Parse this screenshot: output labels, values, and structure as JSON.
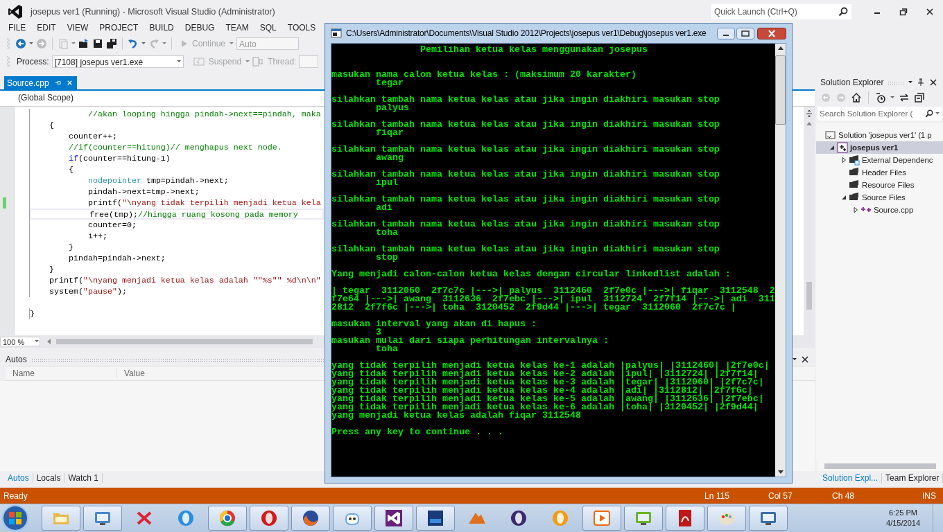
{
  "window": {
    "title": "josepus ver1 (Running) - Microsoft Visual Studio (Administrator)",
    "quick_launch": {
      "placeholder": "Quick Launch (Ctrl+Q)"
    }
  },
  "menu": [
    "FILE",
    "EDIT",
    "VIEW",
    "PROJECT",
    "BUILD",
    "DEBUG",
    "TEAM",
    "SQL",
    "TOOLS"
  ],
  "toolbar": {
    "continue": "Continue",
    "config": "Auto",
    "process_label": "Process:",
    "process": "[7108] josepus ver1.exe",
    "suspend": "Suspend",
    "thread_label": "Thread:"
  },
  "editor": {
    "tabs": [
      {
        "label": "Source.cpp",
        "selected": true
      }
    ],
    "scope": "(Global Scope)",
    "zoom": "100 %",
    "lines": [
      {
        "segments": [
          {
            "kind": "comment",
            "text": "            //akan looping hingga pindah->next==pindah, maka"
          }
        ]
      },
      {
        "segments": [
          {
            "kind": "plain",
            "text": "    {"
          }
        ]
      },
      {
        "segments": [
          {
            "kind": "plain",
            "text": "        counter++;"
          }
        ]
      },
      {
        "segments": [
          {
            "kind": "comment",
            "text": "        //if(counter==hitung)// menghapus next node."
          }
        ]
      },
      {
        "segments": [
          {
            "kind": "keyword",
            "text": "        if"
          },
          {
            "kind": "plain",
            "text": "(counter==hitung-1)"
          }
        ]
      },
      {
        "segments": [
          {
            "kind": "plain",
            "text": "        {"
          }
        ]
      },
      {
        "segments": [
          {
            "kind": "type",
            "text": "            nodepointer"
          },
          {
            "kind": "plain",
            "text": " tmp=pindah->next;"
          }
        ]
      },
      {
        "segments": [
          {
            "kind": "plain",
            "text": "            pindah->next=tmp->next;"
          }
        ]
      },
      {
        "changed": true,
        "segments": [
          {
            "kind": "plain",
            "text": "            printf("
          },
          {
            "kind": "string",
            "text": "\"\\nyang tidak terpilih menjadi ketua kela"
          }
        ]
      },
      {
        "current": true,
        "segments": [
          {
            "kind": "plain",
            "text": "            free(tmp);"
          },
          {
            "kind": "comment",
            "text": "//hingga ruang kosong pada memory"
          }
        ]
      },
      {
        "segments": [
          {
            "kind": "plain",
            "text": "            counter=0;"
          }
        ]
      },
      {
        "segments": [
          {
            "kind": "plain",
            "text": "            i++;"
          }
        ]
      },
      {
        "segments": [
          {
            "kind": "plain",
            "text": "        }"
          }
        ]
      },
      {
        "segments": [
          {
            "kind": "plain",
            "text": "        pindah=pindah->next;"
          }
        ]
      },
      {
        "segments": [
          {
            "kind": "plain",
            "text": "    }"
          }
        ]
      },
      {
        "segments": [
          {
            "kind": "plain",
            "text": "    printf("
          },
          {
            "kind": "string",
            "text": "\"\\nyang menjadi ketua kelas adalah \"\"%s\"\" %d\\n\\n\""
          }
        ]
      },
      {
        "segments": [
          {
            "kind": "plain",
            "text": "    system("
          },
          {
            "kind": "string",
            "text": "\"pause\""
          },
          {
            "kind": "plain",
            "text": ");"
          }
        ]
      },
      {
        "blank_before": true,
        "segments": [
          {
            "kind": "plain",
            "text": "}"
          }
        ]
      }
    ]
  },
  "autos": {
    "title": "Autos",
    "columns": [
      "Name",
      "Value"
    ],
    "tabs": [
      {
        "label": "Autos",
        "selected": true
      },
      {
        "label": "Locals",
        "selected": false
      },
      {
        "label": "Watch 1",
        "selected": false
      }
    ]
  },
  "solution_explorer": {
    "title": "Solution Explorer",
    "search": {
      "placeholder": "Search Solution Explorer ("
    },
    "tree": [
      {
        "label": "Solution 'josepus ver1' (1 p",
        "kind": "solution",
        "selected": false,
        "children": [
          {
            "label": "josepus ver1",
            "kind": "project",
            "expanded": true,
            "selected": true,
            "children": [
              {
                "label": "External Dependenc",
                "kind": "deps",
                "expanded": false,
                "selected": false
              },
              {
                "label": "Header Files",
                "kind": "folder",
                "selected": false
              },
              {
                "label": "Resource Files",
                "kind": "folder",
                "selected": false
              },
              {
                "label": "Source Files",
                "kind": "folder",
                "expanded": true,
                "selected": false,
                "children": [
                  {
                    "label": "Source.cpp",
                    "kind": "file",
                    "expanded": false,
                    "selected": false
                  }
                ]
              }
            ]
          }
        ]
      }
    ],
    "tabs": [
      {
        "label": "Solution Expl...",
        "selected": true
      },
      {
        "label": "Team Explorer",
        "selected": false
      }
    ]
  },
  "status_bar": {
    "state": "Ready",
    "line": "Ln 115",
    "col": "Col 57",
    "ch": "Ch 48",
    "mode": "INS"
  },
  "console": {
    "title": "C:\\Users\\Administrator\\Documents\\Visual Studio 2012\\Projects\\josepus ver1\\Debug\\josepus ver1.exe",
    "blocks": [
      [
        "                Pemilihan ketua kelas menggunakan josepus"
      ],
      [
        "masukan nama calon ketua kelas : (maksimum 20 karakter)",
        "        tegar"
      ],
      [
        "silahkan tambah nama ketua kelas atau jika ingin diakhiri masukan stop",
        "        palyus"
      ],
      [
        "silahkan tambah nama ketua kelas atau jika ingin diakhiri masukan stop",
        "        fiqar"
      ],
      [
        "silahkan tambah nama ketua kelas atau jika ingin diakhiri masukan stop",
        "        awang"
      ],
      [
        "silahkan tambah nama ketua kelas atau jika ingin diakhiri masukan stop",
        "        ipul"
      ],
      [
        "silahkan tambah nama ketua kelas atau jika ingin diakhiri masukan stop",
        "        adi"
      ],
      [
        "silahkan tambah nama ketua kelas atau jika ingin diakhiri masukan stop",
        "        toha"
      ],
      [
        "silahkan tambah nama ketua kelas atau jika ingin diakhiri masukan stop",
        "        stop"
      ],
      [
        "Yang menjadi calon-calon ketua kelas dengan circular linkedlist adalah :"
      ],
      [
        "| tegar  3112060  2f7c7c |--->| palyus  3112460  2f7e0c |--->| fiqar  3112548  2",
        "f7e64 |--->| awang  3112636  2f7ebc |--->| ipul  3112724  2f7f14 |--->| adi  311",
        "2812  2f7f6c |--->| toha  3120452  2f9d44 |--->| tegar  3112060  2f7c7c |"
      ],
      [
        "masukan interval yang akan di hapus :",
        "        3",
        "masukan mulai dari siapa perhitungan intervalnya :",
        "        toha"
      ],
      [
        "yang tidak terpilih menjadi ketua kelas ke-1 adalah |palyus| |3112460| |2f7e0c|",
        "yang tidak terpilih menjadi ketua kelas ke-2 adalah |ipul| |3112724| |2f7f14|",
        "yang tidak terpilih menjadi ketua kelas ke-3 adalah |tegar| |3112060| |2f7c7c|",
        "yang tidak terpilih menjadi ketua kelas ke-4 adalah |adi| |3112812| |2f7f6c|",
        "yang tidak terpilih menjadi ketua kelas ke-5 adalah |awang| |3112636| |2f7ebc|",
        "yang tidak terpilih menjadi ketua kelas ke-6 adalah |toha| |3120452| |2f9d44|",
        "yang menjadi ketua kelas adalah fiqar 3112548"
      ],
      [
        "Press any key to continue . . ."
      ]
    ]
  },
  "taskbar": {
    "clock": {
      "time": "6:25 PM",
      "date": "4/15/2014"
    },
    "buttons": [
      {
        "kind": "folder",
        "running": true
      },
      {
        "kind": "panel",
        "running": true
      },
      {
        "kind": "cross",
        "running": false
      },
      {
        "kind": "globe",
        "running": false
      },
      {
        "kind": "chrome",
        "running": true
      },
      {
        "kind": "ring",
        "running": true
      },
      {
        "kind": "fox",
        "running": true
      },
      {
        "kind": "robot",
        "running": true
      },
      {
        "kind": "vs",
        "running": true
      },
      {
        "kind": "dev",
        "running": true
      },
      {
        "kind": "peak",
        "running": false
      },
      {
        "kind": "sphere",
        "running": false
      },
      {
        "kind": "orange",
        "running": false
      },
      {
        "kind": "play",
        "running": true
      },
      {
        "kind": "tv",
        "running": true
      },
      {
        "kind": "pdf",
        "running": true
      },
      {
        "kind": "palette",
        "running": true
      },
      {
        "kind": "window",
        "running": true
      }
    ]
  }
}
